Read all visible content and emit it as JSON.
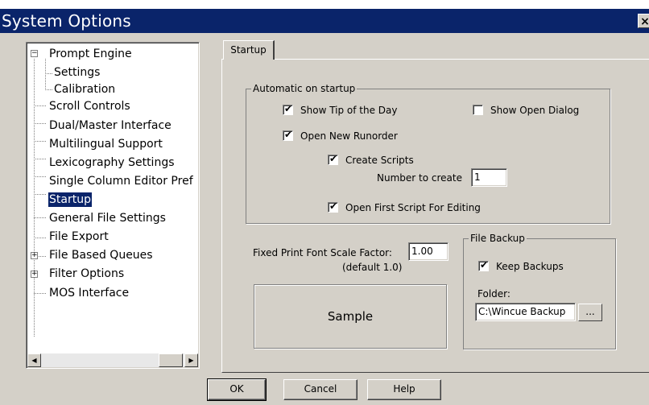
{
  "window": {
    "title": "System Options",
    "close_glyph": "×"
  },
  "tree": {
    "items": [
      {
        "label": "Prompt Engine",
        "level": 0,
        "expander": "−"
      },
      {
        "label": "Settings",
        "level": 1
      },
      {
        "label": "Calibration",
        "level": 1
      },
      {
        "label": "Scroll Controls",
        "level": 0
      },
      {
        "label": "Dual/Master Interface",
        "level": 0
      },
      {
        "label": "Multilingual Support",
        "level": 0
      },
      {
        "label": "Lexicography Settings",
        "level": 0
      },
      {
        "label": "Single Column Editor Pref",
        "level": 0
      },
      {
        "label": "Startup",
        "level": 0,
        "selected": true
      },
      {
        "label": "General File Settings",
        "level": 0
      },
      {
        "label": "File Export",
        "level": 0
      },
      {
        "label": "File Based Queues",
        "level": 0,
        "expander": "+"
      },
      {
        "label": "Filter Options",
        "level": 0,
        "expander": "+"
      },
      {
        "label": "MOS Interface",
        "level": 0
      }
    ],
    "scroll_left_glyph": "◀",
    "scroll_right_glyph": "▶"
  },
  "tab": {
    "label": "Startup"
  },
  "auto_group": {
    "legend": "Automatic on startup",
    "show_tip": {
      "label": "Show Tip of the Day",
      "checked": true
    },
    "show_open": {
      "label": "Show Open Dialog",
      "checked": false
    },
    "open_runorder": {
      "label": "Open New Runorder",
      "checked": true
    },
    "create_scripts": {
      "label": "Create Scripts",
      "checked": true
    },
    "number_label": "Number to create",
    "number_value": "1",
    "open_first": {
      "label": "Open First Script For Editing",
      "checked": true
    }
  },
  "font_scale": {
    "label": "Fixed Print Font Scale Factor:",
    "default_note": "(default 1.0)",
    "value": "1.00"
  },
  "sample": {
    "label": "Sample"
  },
  "backup_group": {
    "legend": "File Backup",
    "keep": {
      "label": "Keep Backups",
      "checked": true
    },
    "folder_label": "Folder:",
    "folder_value": "C:\\Wincue Backup",
    "browse_label": "..."
  },
  "buttons": {
    "ok": "OK",
    "cancel": "Cancel",
    "help": "Help"
  }
}
